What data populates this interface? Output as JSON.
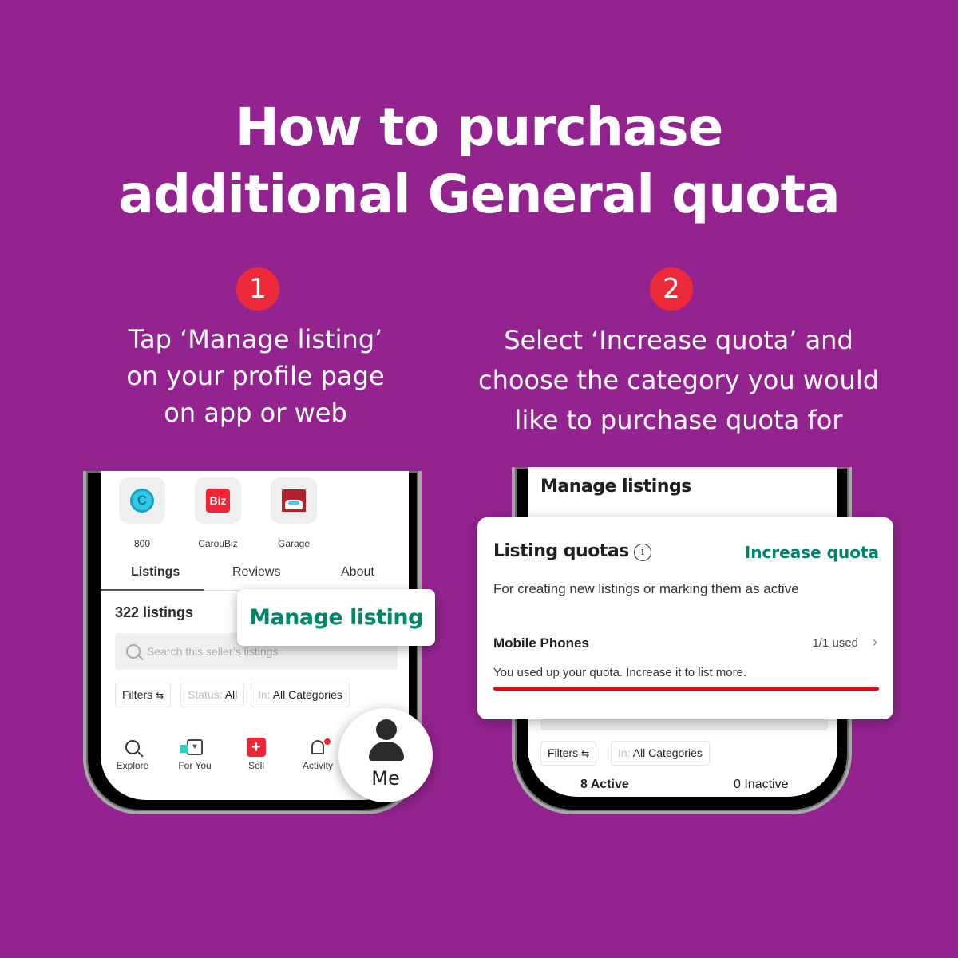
{
  "title": {
    "line1": "How to purchase",
    "line2": "additional General quota"
  },
  "steps": [
    {
      "number": "1",
      "lines": [
        "Tap ‘Manage listing’",
        "on your profile page",
        "on app or web"
      ]
    },
    {
      "number": "2",
      "lines": [
        "Select ‘Increase quota’ and",
        "choose the category you would",
        "like to purchase quota for"
      ]
    }
  ],
  "phone1": {
    "shortcuts": [
      {
        "label": "800",
        "icon": "coin-icon",
        "glyph": "C"
      },
      {
        "label": "CarouBiz",
        "icon": "biz-icon",
        "glyph": "Biz"
      },
      {
        "label": "Garage",
        "icon": "garage-icon"
      }
    ],
    "tabs": [
      {
        "label": "Listings",
        "active": true
      },
      {
        "label": "Reviews",
        "active": false
      },
      {
        "label": "About",
        "active": false
      }
    ],
    "listing_count": "322 listings",
    "search_placeholder": "Search this seller’s listings",
    "filters": {
      "filters_label": "Filters",
      "filter_glyph": "⇆",
      "status_prefix": "Status:",
      "status_value": "All",
      "in_prefix": "In:",
      "in_value": "All Categories"
    },
    "nav": [
      {
        "label": "Explore",
        "icon": "search-icon"
      },
      {
        "label": "For You",
        "icon": "for-you-icon",
        "glyph": "♥"
      },
      {
        "label": "Sell",
        "icon": "plus-icon",
        "glyph": "+"
      },
      {
        "label": "Activity",
        "icon": "bell-icon"
      },
      {
        "label": "Me",
        "icon": "user-icon"
      }
    ],
    "manage_listing_callout": "Manage listing"
  },
  "phone2": {
    "header": "Manage listings",
    "quota_card": {
      "title": "Listing quotas",
      "info_glyph": "i",
      "increase_label": "Increase quota",
      "description": "For creating new listings or marking them as active",
      "category": "Mobile Phones",
      "used_text": "1/1  used",
      "chevron": "›",
      "message": "You used up your quota. Increase it to list more.",
      "usage_fraction": 1.0
    },
    "filters": {
      "filters_label": "Filters",
      "filter_glyph": "⇆",
      "in_prefix": "In:",
      "in_value": "All Categories"
    },
    "active_count": "8 Active",
    "inactive_count": "0 Inactive"
  },
  "colors": {
    "background": "#93248f",
    "badge": "#ec2a3a",
    "accent_green": "#00866b",
    "progress_red": "#d0121f"
  }
}
